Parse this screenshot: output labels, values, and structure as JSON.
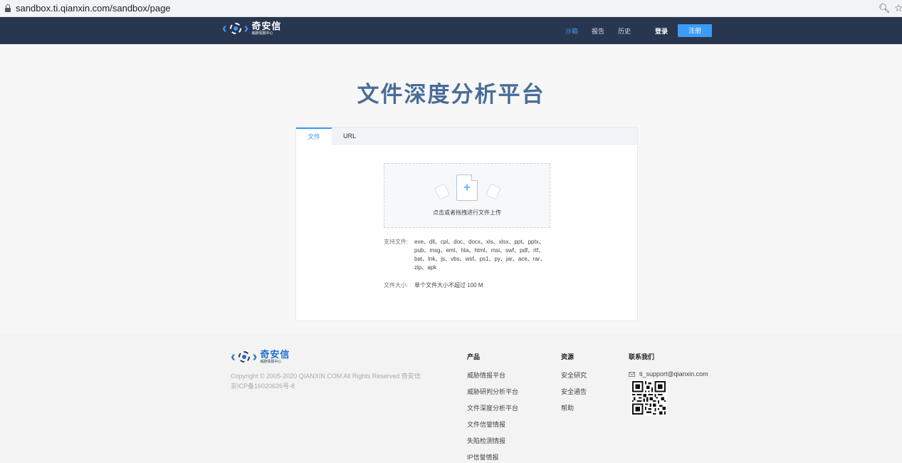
{
  "browser": {
    "url": "sandbox.ti.qianxin.com/sandbox/page"
  },
  "header": {
    "logo": {
      "name": "奇安信",
      "sub": "威胁情报中心"
    },
    "nav": [
      {
        "label": "沙箱",
        "active": true
      },
      {
        "label": "报告"
      },
      {
        "label": "历史"
      }
    ],
    "login_label": "登录",
    "register_label": "注册"
  },
  "main": {
    "title": "文件深度分析平台",
    "tabs": [
      {
        "label": "文件",
        "active": true
      },
      {
        "label": "URL"
      }
    ],
    "upload_hint": "点击或者拖拽进行文件上传",
    "supported_label": "支持文件:",
    "supported_types": "exe、dll、cpl、doc、docx、xls、xlsx、ppt、pptx、pub、msg、eml、hta、html、msi、swf、pdf、rtf、bat、lnk、js、vbs、wsf、ps1、py、jar、ace、rar、zip、apk",
    "size_label": "文件大小:",
    "size_value": "单个文件大小不超过 100 M"
  },
  "footer": {
    "logo": {
      "name": "奇安信",
      "sub": "威胁情报中心"
    },
    "copyright": "Copyright © 2005-2020 QIANXIN.COM All Rights Reserved 奇安信",
    "icp": "京ICP备16020626号-8",
    "products": {
      "title": "产品",
      "items": [
        "威胁情报平台",
        "威胁研判分析平台",
        "文件深度分析平台",
        "文件信誉情报",
        "失陷检测情报",
        "IP信誉情报"
      ]
    },
    "resources": {
      "title": "资源",
      "items": [
        "安全研究",
        "安全通告",
        "帮助"
      ]
    },
    "contact": {
      "title": "联系我们",
      "email": "ti_support@qianxin.com"
    }
  },
  "colors": {
    "header_bg": "#28364f",
    "accent": "#3a9cf5",
    "title": "#4a6d99"
  }
}
